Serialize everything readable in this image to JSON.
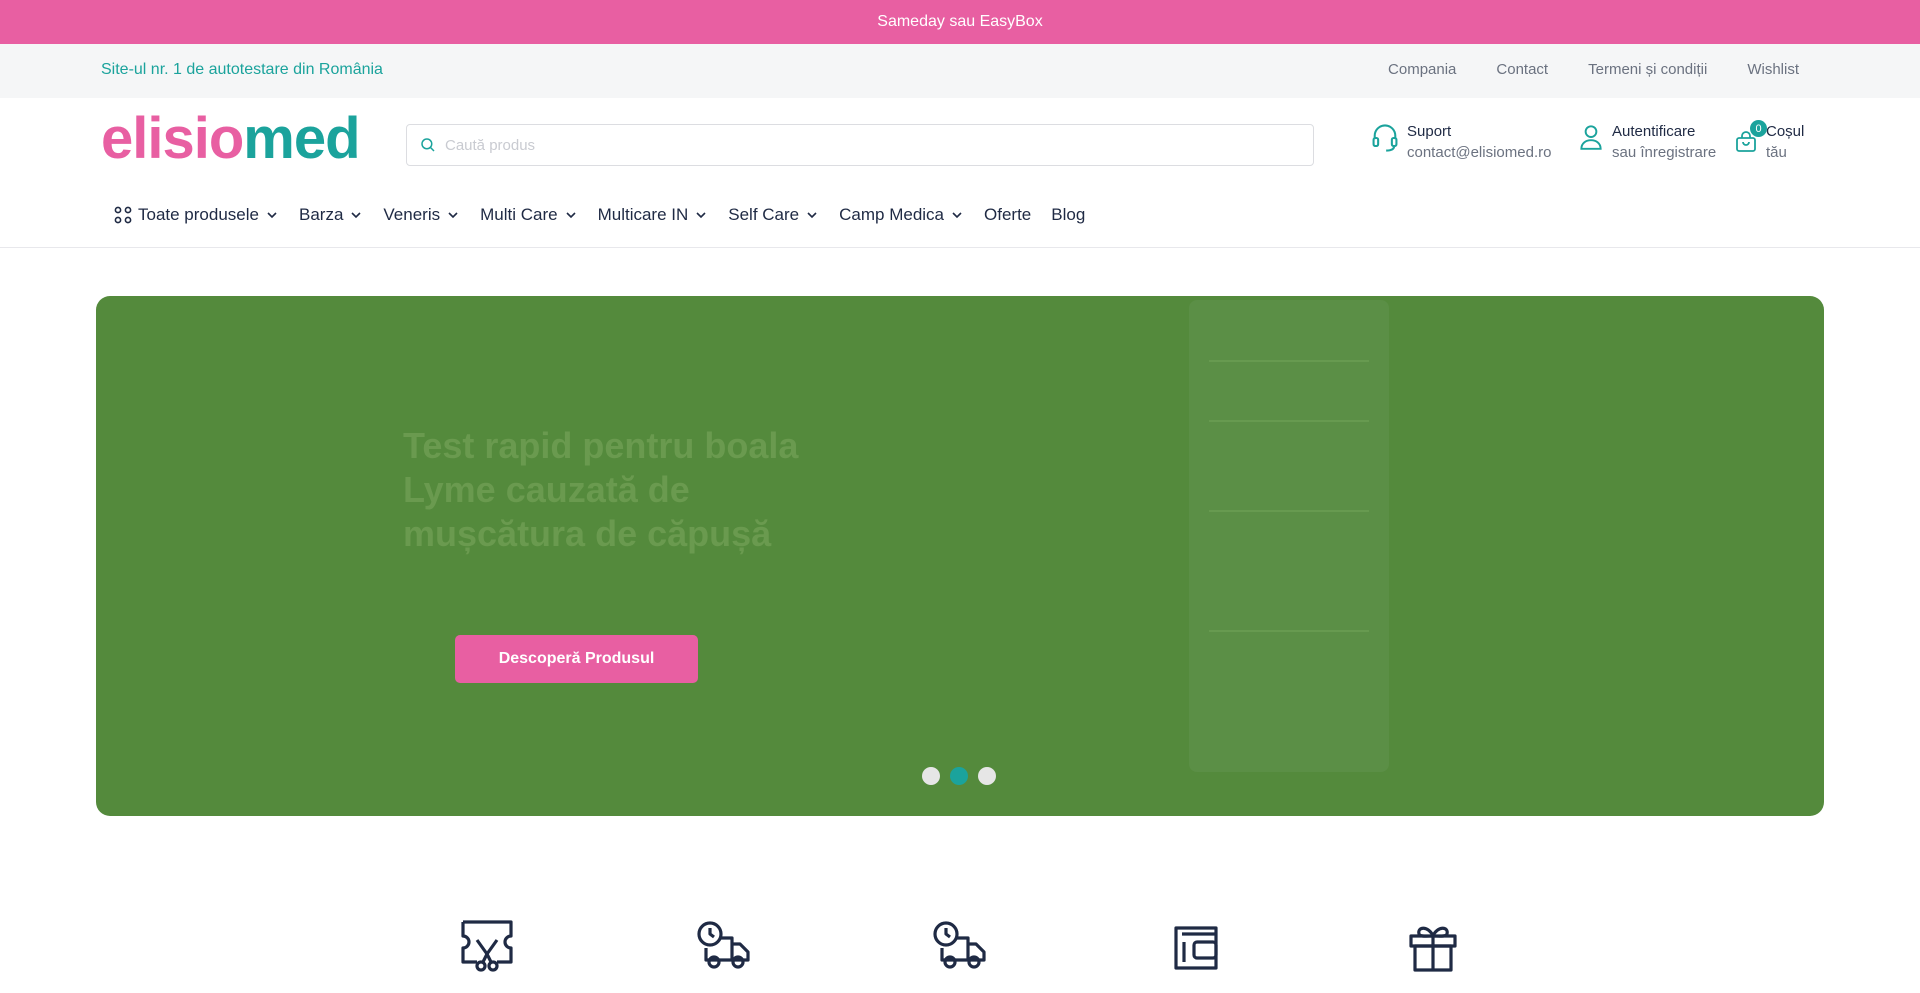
{
  "promo": {
    "text": "Sameday sau EasyBox"
  },
  "utility": {
    "tagline": "Site-ul nr. 1 de autotestare din România",
    "links": [
      "Compania",
      "Contact",
      "Termeni și condiții",
      "Wishlist"
    ]
  },
  "header": {
    "logo": {
      "part1": "elisio",
      "part2": "med"
    },
    "search": {
      "placeholder": "Caută produs",
      "value": ""
    },
    "support": {
      "title": "Suport",
      "subtitle": "contact@elisiomed.ro"
    },
    "account": {
      "title": "Autentificare",
      "subtitle": "sau înregistrare"
    },
    "cart": {
      "title": "Coșul",
      "subtitle": "tău",
      "count": "0"
    }
  },
  "nav": {
    "items": [
      {
        "label": "Toate produsele",
        "dropdown": true
      },
      {
        "label": "Barza",
        "dropdown": true
      },
      {
        "label": "Veneris",
        "dropdown": true
      },
      {
        "label": "Multi Care",
        "dropdown": true
      },
      {
        "label": "Multicare IN",
        "dropdown": true
      },
      {
        "label": "Self Care",
        "dropdown": true
      },
      {
        "label": "Camp Medica",
        "dropdown": true
      },
      {
        "label": "Oferte",
        "dropdown": false
      },
      {
        "label": "Blog",
        "dropdown": false
      }
    ]
  },
  "hero": {
    "title": "Test rapid pentru boala Lyme cauzată de mușcătura de căpușă",
    "button": "Descoperă Produsul",
    "slides": 3,
    "active_slide": 2,
    "background_color": "#548a3c"
  },
  "features": {
    "icons": [
      "ticket-scissors-icon",
      "delivery-truck-clock-icon",
      "delivery-truck-clock-icon",
      "wallet-icon",
      "gift-icon"
    ]
  },
  "colors": {
    "pink": "#e85fa2",
    "teal": "#1ba39c",
    "navy": "#1f2a44"
  }
}
